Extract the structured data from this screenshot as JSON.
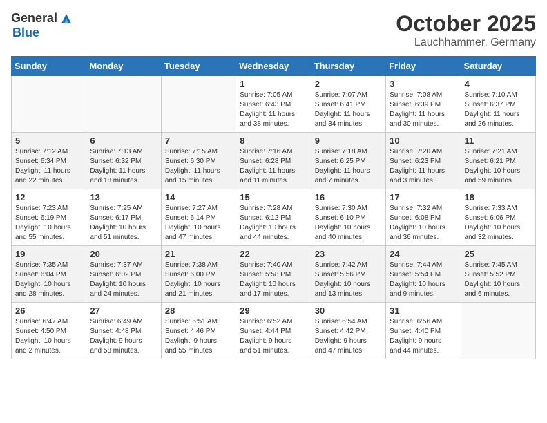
{
  "header": {
    "logo_general": "General",
    "logo_blue": "Blue",
    "month": "October 2025",
    "location": "Lauchhammer, Germany"
  },
  "weekdays": [
    "Sunday",
    "Monday",
    "Tuesday",
    "Wednesday",
    "Thursday",
    "Friday",
    "Saturday"
  ],
  "weeks": [
    [
      {
        "day": "",
        "info": ""
      },
      {
        "day": "",
        "info": ""
      },
      {
        "day": "",
        "info": ""
      },
      {
        "day": "1",
        "info": "Sunrise: 7:05 AM\nSunset: 6:43 PM\nDaylight: 11 hours\nand 38 minutes."
      },
      {
        "day": "2",
        "info": "Sunrise: 7:07 AM\nSunset: 6:41 PM\nDaylight: 11 hours\nand 34 minutes."
      },
      {
        "day": "3",
        "info": "Sunrise: 7:08 AM\nSunset: 6:39 PM\nDaylight: 11 hours\nand 30 minutes."
      },
      {
        "day": "4",
        "info": "Sunrise: 7:10 AM\nSunset: 6:37 PM\nDaylight: 11 hours\nand 26 minutes."
      }
    ],
    [
      {
        "day": "5",
        "info": "Sunrise: 7:12 AM\nSunset: 6:34 PM\nDaylight: 11 hours\nand 22 minutes."
      },
      {
        "day": "6",
        "info": "Sunrise: 7:13 AM\nSunset: 6:32 PM\nDaylight: 11 hours\nand 18 minutes."
      },
      {
        "day": "7",
        "info": "Sunrise: 7:15 AM\nSunset: 6:30 PM\nDaylight: 11 hours\nand 15 minutes."
      },
      {
        "day": "8",
        "info": "Sunrise: 7:16 AM\nSunset: 6:28 PM\nDaylight: 11 hours\nand 11 minutes."
      },
      {
        "day": "9",
        "info": "Sunrise: 7:18 AM\nSunset: 6:25 PM\nDaylight: 11 hours\nand 7 minutes."
      },
      {
        "day": "10",
        "info": "Sunrise: 7:20 AM\nSunset: 6:23 PM\nDaylight: 11 hours\nand 3 minutes."
      },
      {
        "day": "11",
        "info": "Sunrise: 7:21 AM\nSunset: 6:21 PM\nDaylight: 10 hours\nand 59 minutes."
      }
    ],
    [
      {
        "day": "12",
        "info": "Sunrise: 7:23 AM\nSunset: 6:19 PM\nDaylight: 10 hours\nand 55 minutes."
      },
      {
        "day": "13",
        "info": "Sunrise: 7:25 AM\nSunset: 6:17 PM\nDaylight: 10 hours\nand 51 minutes."
      },
      {
        "day": "14",
        "info": "Sunrise: 7:27 AM\nSunset: 6:14 PM\nDaylight: 10 hours\nand 47 minutes."
      },
      {
        "day": "15",
        "info": "Sunrise: 7:28 AM\nSunset: 6:12 PM\nDaylight: 10 hours\nand 44 minutes."
      },
      {
        "day": "16",
        "info": "Sunrise: 7:30 AM\nSunset: 6:10 PM\nDaylight: 10 hours\nand 40 minutes."
      },
      {
        "day": "17",
        "info": "Sunrise: 7:32 AM\nSunset: 6:08 PM\nDaylight: 10 hours\nand 36 minutes."
      },
      {
        "day": "18",
        "info": "Sunrise: 7:33 AM\nSunset: 6:06 PM\nDaylight: 10 hours\nand 32 minutes."
      }
    ],
    [
      {
        "day": "19",
        "info": "Sunrise: 7:35 AM\nSunset: 6:04 PM\nDaylight: 10 hours\nand 28 minutes."
      },
      {
        "day": "20",
        "info": "Sunrise: 7:37 AM\nSunset: 6:02 PM\nDaylight: 10 hours\nand 24 minutes."
      },
      {
        "day": "21",
        "info": "Sunrise: 7:38 AM\nSunset: 6:00 PM\nDaylight: 10 hours\nand 21 minutes."
      },
      {
        "day": "22",
        "info": "Sunrise: 7:40 AM\nSunset: 5:58 PM\nDaylight: 10 hours\nand 17 minutes."
      },
      {
        "day": "23",
        "info": "Sunrise: 7:42 AM\nSunset: 5:56 PM\nDaylight: 10 hours\nand 13 minutes."
      },
      {
        "day": "24",
        "info": "Sunrise: 7:44 AM\nSunset: 5:54 PM\nDaylight: 10 hours\nand 9 minutes."
      },
      {
        "day": "25",
        "info": "Sunrise: 7:45 AM\nSunset: 5:52 PM\nDaylight: 10 hours\nand 6 minutes."
      }
    ],
    [
      {
        "day": "26",
        "info": "Sunrise: 6:47 AM\nSunset: 4:50 PM\nDaylight: 10 hours\nand 2 minutes."
      },
      {
        "day": "27",
        "info": "Sunrise: 6:49 AM\nSunset: 4:48 PM\nDaylight: 9 hours\nand 58 minutes."
      },
      {
        "day": "28",
        "info": "Sunrise: 6:51 AM\nSunset: 4:46 PM\nDaylight: 9 hours\nand 55 minutes."
      },
      {
        "day": "29",
        "info": "Sunrise: 6:52 AM\nSunset: 4:44 PM\nDaylight: 9 hours\nand 51 minutes."
      },
      {
        "day": "30",
        "info": "Sunrise: 6:54 AM\nSunset: 4:42 PM\nDaylight: 9 hours\nand 47 minutes."
      },
      {
        "day": "31",
        "info": "Sunrise: 6:56 AM\nSunset: 4:40 PM\nDaylight: 9 hours\nand 44 minutes."
      },
      {
        "day": "",
        "info": ""
      }
    ]
  ]
}
